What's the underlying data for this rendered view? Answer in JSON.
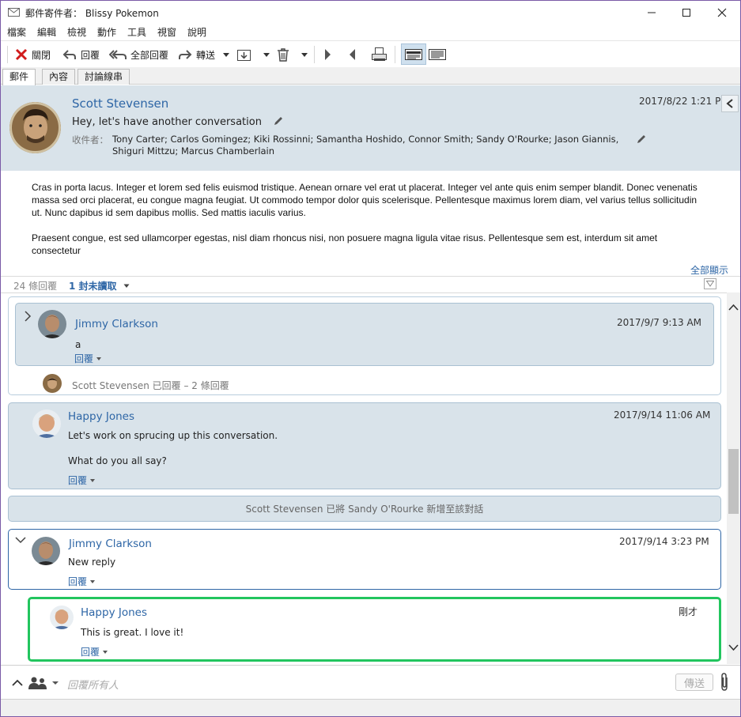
{
  "window": {
    "title": "郵件寄件者： Blissy Pokemon"
  },
  "menu": [
    "檔案",
    "編輯",
    "檢視",
    "動作",
    "工具",
    "視窗",
    "說明"
  ],
  "toolbar": {
    "close": "關閉",
    "reply": "回覆",
    "reply_all": "全部回覆",
    "forward": "轉送"
  },
  "tabs": [
    "郵件",
    "內容",
    "討論線串"
  ],
  "message": {
    "sender": "Scott Stevensen",
    "subject": "Hey, let's have another conversation",
    "recipients_label": "收件者：",
    "recipients": "Tony Carter; Carlos Gomingez; Kiki Rossinni; Samantha Hoshido, Connor Smith; Sandy O'Rourke; Jason Giannis, Shiguri Mittzu; Marcus Chamberlain",
    "date": "2017/8/22 1:21 PM",
    "body": [
      "Cras in porta lacus. Integer et lorem sed felis euismod tristique. Aenean ornare vel erat ut placerat. Integer vel ante quis enim semper blandit. Donec venenatis massa sed orci placerat, eu congue magna feugiat. Ut commodo tempor dolor quis scelerisque. Pellentesque maximus lorem diam, vel varius tellus sollicitudin ut. Nunc dapibus id sem dapibus mollis. Sed mattis iaculis varius.",
      "Praesent congue, est sed ullamcorper egestas, nisl diam rhoncus nisi, non posuere magna ligula vitae risus. Pellentesque sem est, interdum sit amet consectetur"
    ],
    "show_all": "全部顯示"
  },
  "replies_bar": {
    "count": "24 條回覆",
    "unread": "1 封未讀取"
  },
  "thread": {
    "reply_label": "回覆",
    "items": [
      {
        "name": "Jimmy Clarkson",
        "date": "2017/9/7 9:13 AM",
        "text": "a"
      },
      {
        "summary": "Scott Stevensen 已回覆 – 2 條回覆"
      },
      {
        "name": "Happy Jones",
        "date": "2017/9/14 11:06 AM",
        "text": "Let's work on sprucing up this conversation.",
        "text2": "What do you all say?"
      },
      {
        "notice": "Scott Stevensen 已將 Sandy O'Rourke 新增至該對話"
      },
      {
        "name": "Jimmy Clarkson",
        "date": "2017/9/14 3:23 PM",
        "text": "New reply"
      },
      {
        "name": "Happy Jones",
        "date": "剛才",
        "text": "This is great. I love it!"
      }
    ]
  },
  "compose": {
    "placeholder": "回覆所有人",
    "send": "傳送"
  },
  "colors": {
    "accent": "#2e66a6",
    "header_bg": "#d9e3ea",
    "card_bg": "#d9e3ea",
    "new_highlight": "#22c55e",
    "close_red": "#d11b1b"
  }
}
